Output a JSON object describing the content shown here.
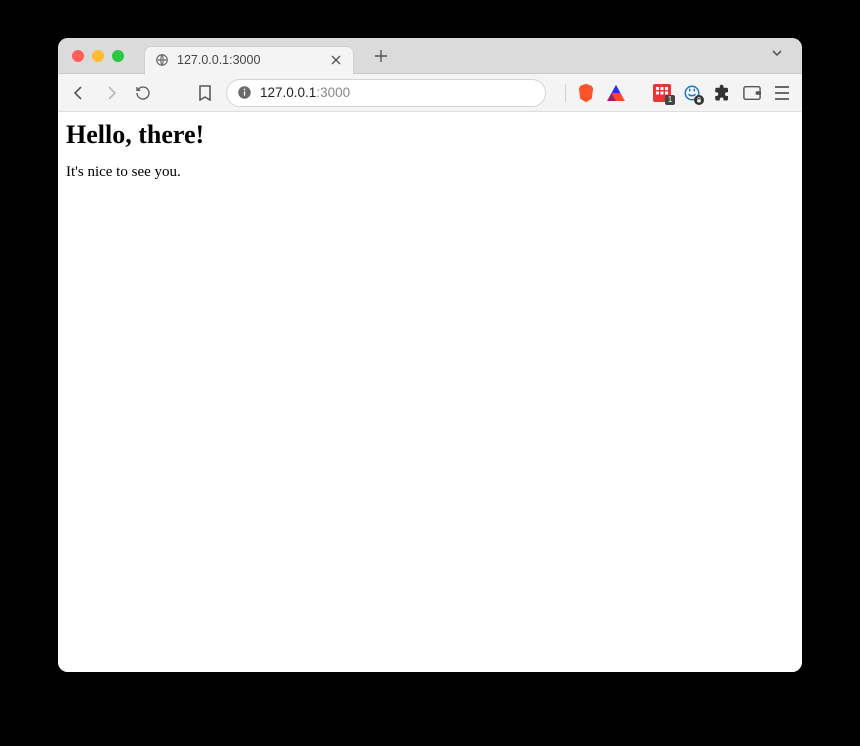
{
  "window": {
    "tab": {
      "title": "127.0.0.1:3000"
    }
  },
  "toolbar": {
    "address": {
      "host": "127.0.0.1",
      "port": ":3000"
    },
    "extensions": {
      "badge_count": "1"
    }
  },
  "page": {
    "heading": "Hello, there!",
    "body": "It's nice to see you."
  }
}
